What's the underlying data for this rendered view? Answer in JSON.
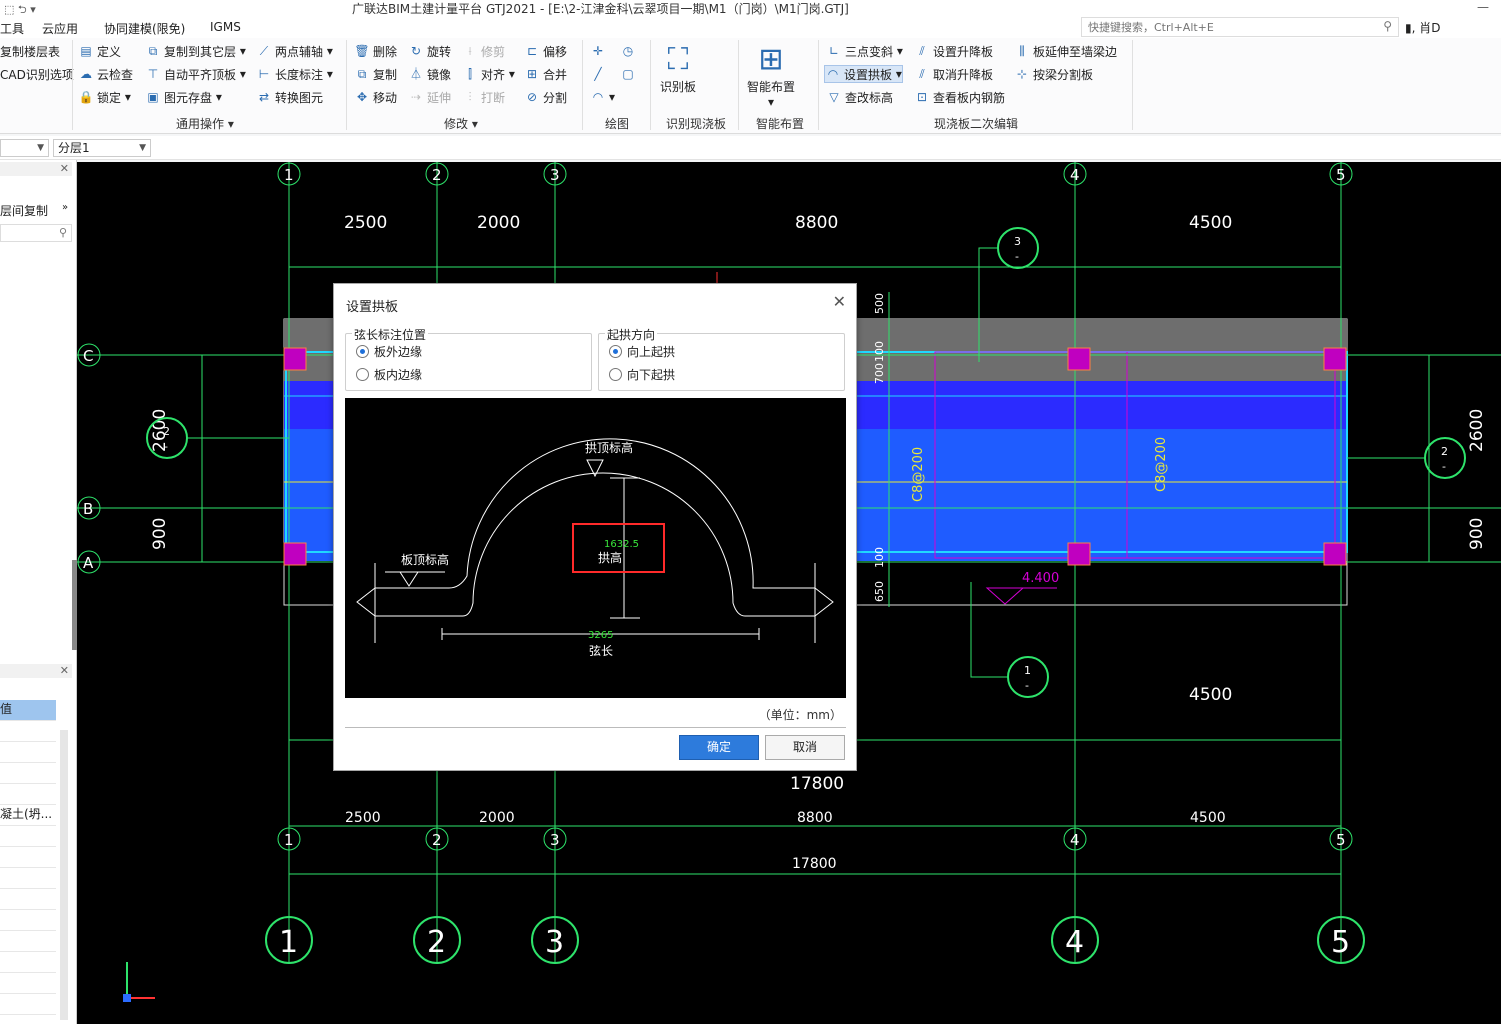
{
  "window": {
    "title": "广联达BIM土建计量平台 GTJ2021 - [E:\\2-江津金科\\云翠项目一期\\M1（门岗）\\M1门岗.GTJ]",
    "quick_access": "⬚ ⮌ ▾",
    "minimize": "—"
  },
  "menu": {
    "items": [
      "工具",
      "云应用",
      "协同建模(限免)",
      "IGMS"
    ]
  },
  "search": {
    "placeholder": "快捷键搜索，Ctrl+Alt+E"
  },
  "user": {
    "label": "肖D"
  },
  "ribbon": {
    "left_items": [
      "复制楼层表",
      "CAD识别选项"
    ],
    "general": {
      "group_label": "通用操作",
      "items": [
        "定义",
        "复制到其它层",
        "两点辅轴",
        "云检查",
        "自动平齐顶板",
        "长度标注",
        "锁定",
        "图元存盘",
        "转换图元"
      ]
    },
    "modify": {
      "group_label": "修改",
      "items": [
        "删除",
        "旋转",
        "修剪",
        "偏移",
        "复制",
        "镜像",
        "对齐",
        "合并",
        "移动",
        "延伸",
        "打断",
        "分割"
      ]
    },
    "draw": {
      "group_label": "绘图"
    },
    "recognize": {
      "group_label": "识别现浇板",
      "button": "识别板"
    },
    "smart": {
      "group_label": "智能布置",
      "button": "智能布置"
    },
    "secondary": {
      "group_label": "现浇板二次编辑",
      "items": [
        "三点变斜",
        "设置升降板",
        "板延伸至墙梁边",
        "设置拱板",
        "取消升降板",
        "按梁分割板",
        "查改标高",
        "查看板内钢筋"
      ]
    }
  },
  "toolbar2": {
    "layer_combo": "分层1"
  },
  "left_panel": {
    "top_label": "层间复制",
    "rows": [
      "值",
      "",
      "",
      "",
      "",
      "凝土(坍...",
      "",
      "",
      "",
      "",
      "",
      "",
      "",
      "",
      ""
    ]
  },
  "cad": {
    "axis_numbers": [
      "1",
      "2",
      "3",
      "4",
      "5"
    ],
    "axis_letters": [
      "C",
      "B",
      "A"
    ],
    "top_dims": [
      "2500",
      "2000",
      "8800",
      "4500"
    ],
    "bottom_dims": [
      "2500",
      "2000",
      "8800",
      "4500"
    ],
    "total_dim": "17800",
    "right_dims": [
      "2600",
      "900"
    ],
    "left_dims": [
      "2600",
      "900"
    ],
    "mid_dims": [
      "500",
      "100",
      "700",
      "100",
      "650"
    ],
    "rebar_labels": [
      "C8@200",
      "C8@200"
    ],
    "elevation": "4.400",
    "section_marks": [
      {
        "num": "3",
        "sub": "-"
      },
      {
        "num": "2",
        "sub": "-"
      },
      {
        "num": "2",
        "sub": "-"
      },
      {
        "num": "1",
        "sub": "-"
      }
    ],
    "lower_dim_4500": "4500",
    "lower_dim_17800": "17800",
    "colors": {
      "background": "#000000",
      "axis": "#2ee36b",
      "slab_blue": "#1f5cff",
      "slab_cyan": "#20d8ff",
      "column": "#c000c0",
      "beam_yellow": "#e8e83a",
      "gray": "#6e6e6e",
      "magenta": "#d400d4",
      "red_line": "#ff3030"
    }
  },
  "dialog": {
    "title": "设置拱板",
    "chord_group": {
      "legend": "弦长标注位置",
      "options": [
        "板外边缘",
        "板内边缘"
      ],
      "selected": 0
    },
    "direction_group": {
      "legend": "起拱方向",
      "options": [
        "向上起拱",
        "向下起拱"
      ],
      "selected": 0
    },
    "preview": {
      "arch_top_label": "拱顶标高",
      "slab_top_label": "板顶标高",
      "rise_value": "1632.5",
      "rise_label": "拱高",
      "chord_value": "3265",
      "chord_label": "弦长"
    },
    "unit": "（单位：mm）",
    "ok": "确定",
    "cancel": "取消"
  }
}
